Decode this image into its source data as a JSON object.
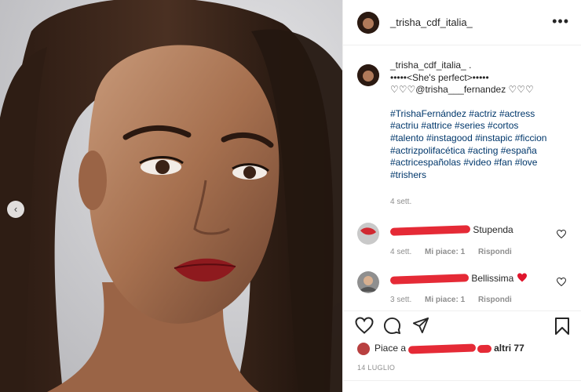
{
  "post": {
    "username": "_trisha_cdf_italia_",
    "more_label": "•••"
  },
  "caption": {
    "username": "_trisha_cdf_italia_",
    "suffix": ".",
    "line1": "•••••<She's perfect>•••••",
    "line2": "♡♡♡@trisha___fernandez ♡♡♡",
    "tags": [
      "#TrishaFernández #actriz #actress",
      "#actriu #attrice #series #cortos",
      "#talento #instagood #instapic #ficcion",
      "#actrizpolifacética #acting #españa",
      "#actricespañolas #video #fan #love",
      "#trishers"
    ],
    "time": "4 sett."
  },
  "comments": [
    {
      "text": "Stupenda",
      "time": "4 sett.",
      "likes": "Mi piace: 1",
      "reply": "Rispondi"
    },
    {
      "text": "Bellissima",
      "time": "3 sett.",
      "likes": "Mi piace: 1",
      "reply": "Rispondi"
    }
  ],
  "likes": {
    "prefix": "Piace a",
    "suffix": "altri 77"
  },
  "date": "14 LUGLIO",
  "icons": [
    "heart-icon",
    "comment-icon",
    "share-icon",
    "bookmark-icon",
    "more-icon",
    "chevron-left-icon"
  ],
  "colors": {
    "link": "#00376b",
    "redaction": "#e52a36",
    "heart_red": "#ed4956"
  }
}
